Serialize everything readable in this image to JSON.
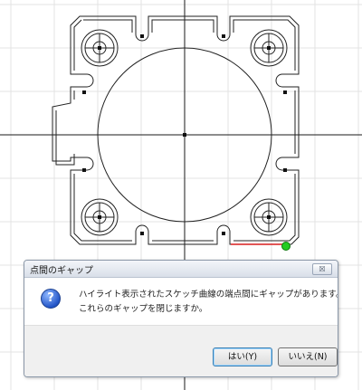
{
  "colors": {
    "grid": "#e3e3e3",
    "axis": "#1a1a1a",
    "sketch": "#222222",
    "highlight": "#d81e1e",
    "endpoint": "#22cc22"
  },
  "dialog": {
    "title": "点間のギャップ",
    "close_label": "☒",
    "icon": "question-icon",
    "icon_glyph": "?",
    "message_line1": "ハイライト表示されたスケッチ曲線の端点間にギャップがあります。",
    "message_line2": "これらのギャップを閉じますか。",
    "yes_label": "はい(Y)",
    "no_label": "いいえ(N)"
  }
}
